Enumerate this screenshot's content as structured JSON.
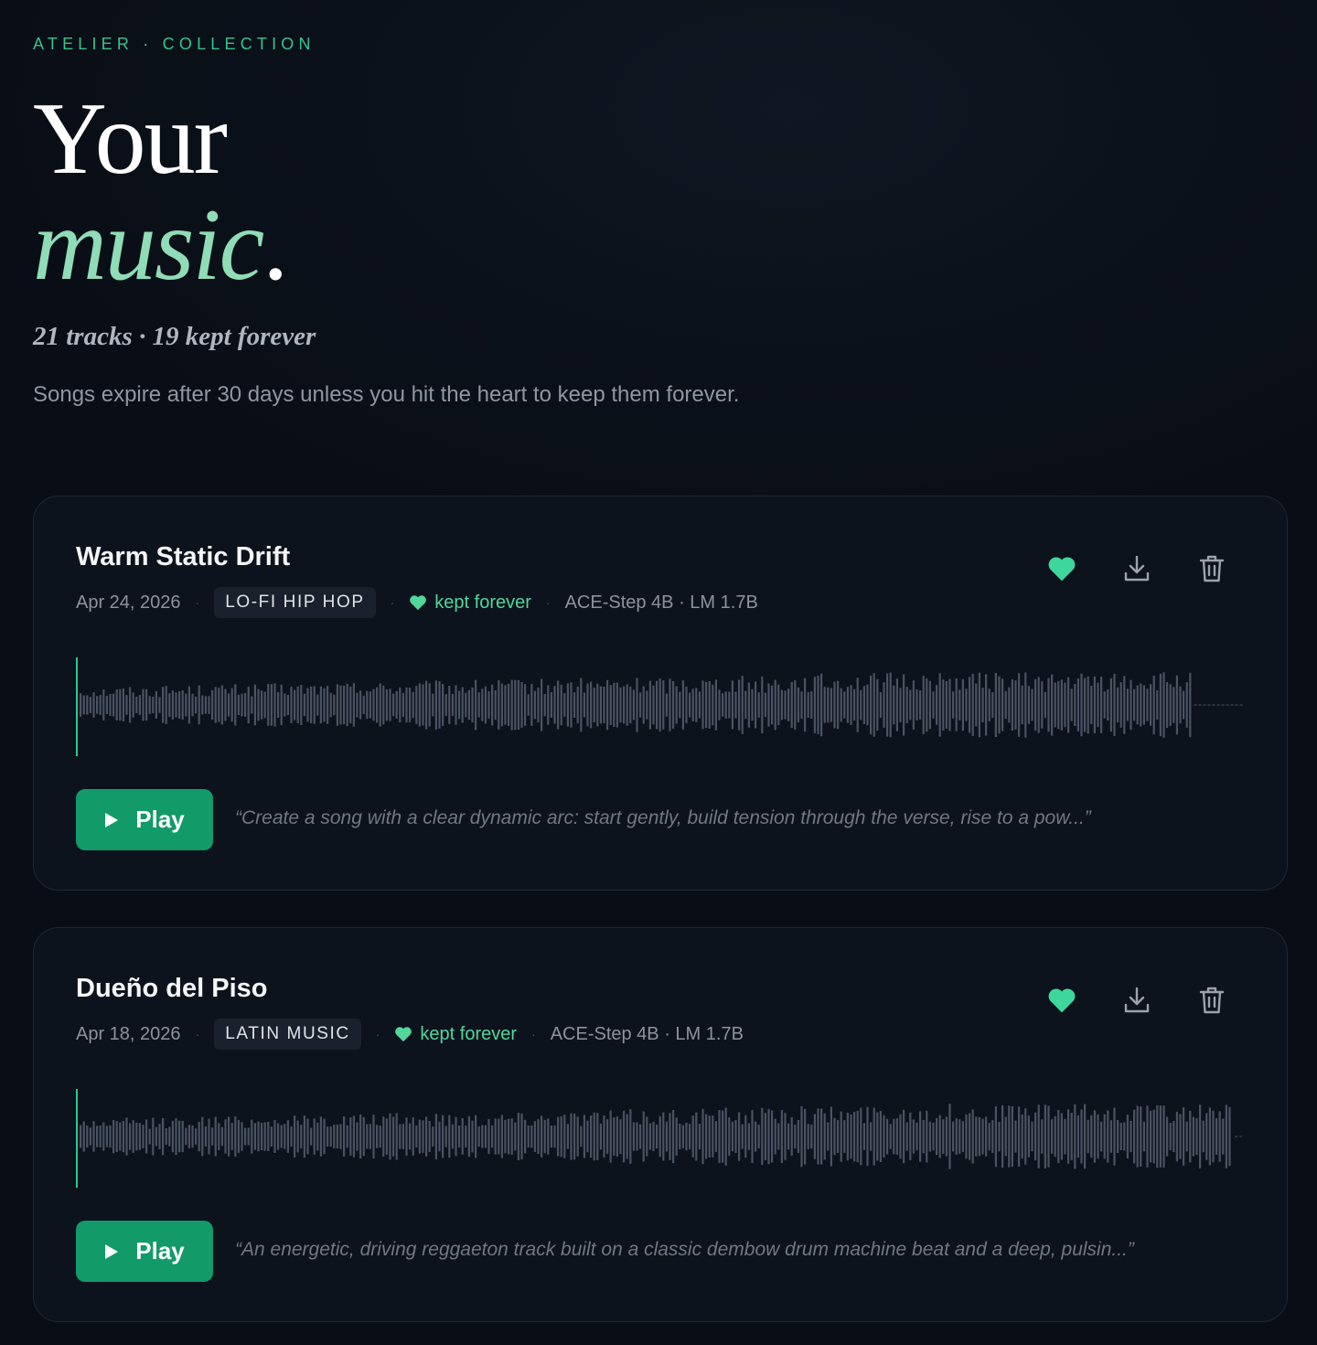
{
  "header": {
    "eyebrow": "ATELIER · COLLECTION",
    "title_line1": "Your",
    "title_accent": "music",
    "title_dot": ".",
    "stats": "21 tracks · 19 kept forever",
    "description": "Songs expire after 30 days unless you hit the heart to keep them forever."
  },
  "colors": {
    "accent": "#35c48c",
    "play_button": "#129a68",
    "heart": "#3ed69a"
  },
  "tracks": [
    {
      "title": "Warm Static Drift",
      "date": "Apr 24, 2026",
      "genre": "LO-FI HIP HOP",
      "kept_label": "kept forever",
      "model": "ACE-Step 4B · LM 1.7B",
      "play_label": "Play",
      "prompt": "“Create a song with a clear dynamic arc: start gently, build tension through the verse, rise to a pow...”",
      "progress": 0,
      "waveform_fraction": 0.955,
      "icons": [
        "heart-icon",
        "download-icon",
        "trash-icon",
        "play-icon"
      ]
    },
    {
      "title": "Dueño del Piso",
      "date": "Apr 18, 2026",
      "genre": "LATIN MUSIC",
      "kept_label": "kept forever",
      "model": "ACE-Step 4B · LM 1.7B",
      "play_label": "Play",
      "prompt": "“An energetic, driving reggaeton track built on a classic dembow drum machine beat and a deep, pulsin...”",
      "progress": 0,
      "waveform_fraction": 0.99,
      "icons": [
        "heart-icon",
        "download-icon",
        "trash-icon",
        "play-icon"
      ]
    }
  ]
}
